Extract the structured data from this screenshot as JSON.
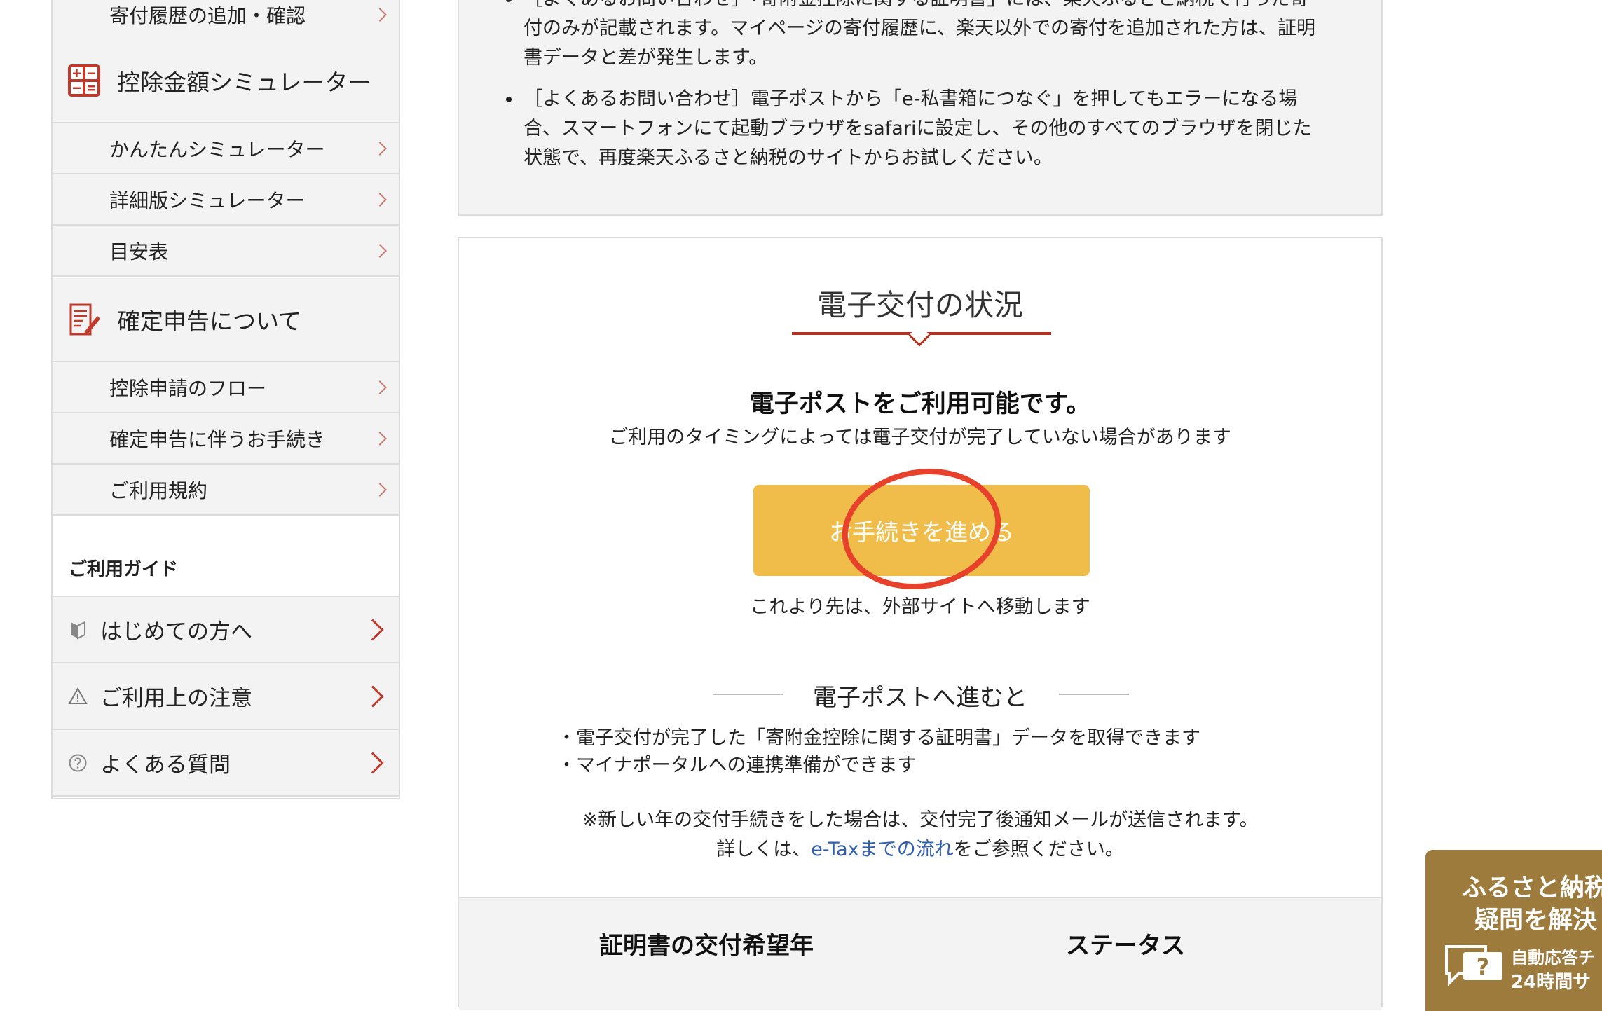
{
  "sidebar": {
    "donation_history": "寄付履歴の追加・確認",
    "simulator_head": "控除金額シミュレーター",
    "simple_sim": "かんたんシミュレーター",
    "detailed_sim": "詳細版シミュレーター",
    "guide_table": "目安表",
    "tax_return_head": "確定申告について",
    "deduction_flow": "控除申請のフロー",
    "tax_procedures": "確定申告に伴うお手続き",
    "terms": "ご利用規約",
    "guide_title": "ご利用ガイド",
    "first_time": "はじめての方へ",
    "cautions": "ご利用上の注意",
    "faq": "よくある質問"
  },
  "notice": {
    "item1_line1": "［よくあるお問い合わせ］「寄附金控除に関する証明書」には、楽天ふるさと納税で行った寄",
    "item1_line2": "付のみが記載されます。マイページの寄付履歴に、楽天以外での寄付を追加された方は、証明",
    "item1_line3": "書データと差が発生します。",
    "item2_line1": "［よくあるお問い合わせ］電子ポストから「e-私書箱につなぐ」を押してもエラーになる場",
    "item2_line2": "合、スマートフォンにて起動ブラウザをsafariに設定し、その他のすべてのブラウザを閉じた",
    "item2_line3": "状態で、再度楽天ふるさと納税のサイトからお試しください。"
  },
  "main": {
    "title": "電子交付の状況",
    "headline": "電子ポストをご利用可能です。",
    "subline": "ご利用のタイミングによっては電子交付が完了していない場合があります",
    "proceed_button": "お手続きを進める",
    "external_note": "これより先は、外部サイトへ移動します",
    "section_title": "電子ポストへ進むと",
    "bullet1": "・電子交付が完了した「寄附金控除に関する証明書」データを取得できます",
    "bullet2": "・マイナポータルへの連携準備ができます",
    "note1": "※新しい年の交付手続きをした場合は、交付完了後通知メールが送信されます。",
    "note2_prefix": "詳しくは、",
    "note2_link": "e-Taxまでの流れ",
    "note2_suffix": "をご参照ください。",
    "table_col1": "証明書の交付希望年",
    "table_col2": "ステータス"
  },
  "chat_widget": {
    "line1": "ふるさと納税",
    "line2": "疑問を解決",
    "line3": "自動応答チ",
    "line4": "24時間サ"
  },
  "colors": {
    "accent_red": "#b4301f",
    "button_yellow": "#f1bd4a",
    "link_blue": "#2f5fae",
    "widget_brown": "#9c7b3d",
    "annotation_circle": "#e8412b"
  }
}
